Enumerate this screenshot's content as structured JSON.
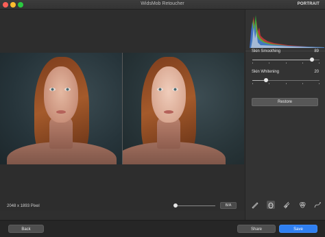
{
  "window": {
    "title": "WidsMob Retoucher",
    "mode": "PORTRAIT"
  },
  "canvas": {
    "image_info": "2048 x 1893 Pixel",
    "zoom_level": 0,
    "ba_toggle": "B/A"
  },
  "panel": {
    "sliders": [
      {
        "label": "Skin Smoothing",
        "value": "89",
        "level": 0.89
      },
      {
        "label": "Skin Whitening",
        "value": "20",
        "level": 0.2
      }
    ],
    "restore": "Restore",
    "tools": [
      "brush-icon",
      "face-icon",
      "comb-icon",
      "color-mix-icon",
      "curve-icon"
    ],
    "active_tool": 1
  },
  "footer": {
    "back": "Back",
    "share": "Share",
    "save": "Save"
  },
  "colors": {
    "accent": "#2f7ff1",
    "background": "#2f2f2f"
  }
}
